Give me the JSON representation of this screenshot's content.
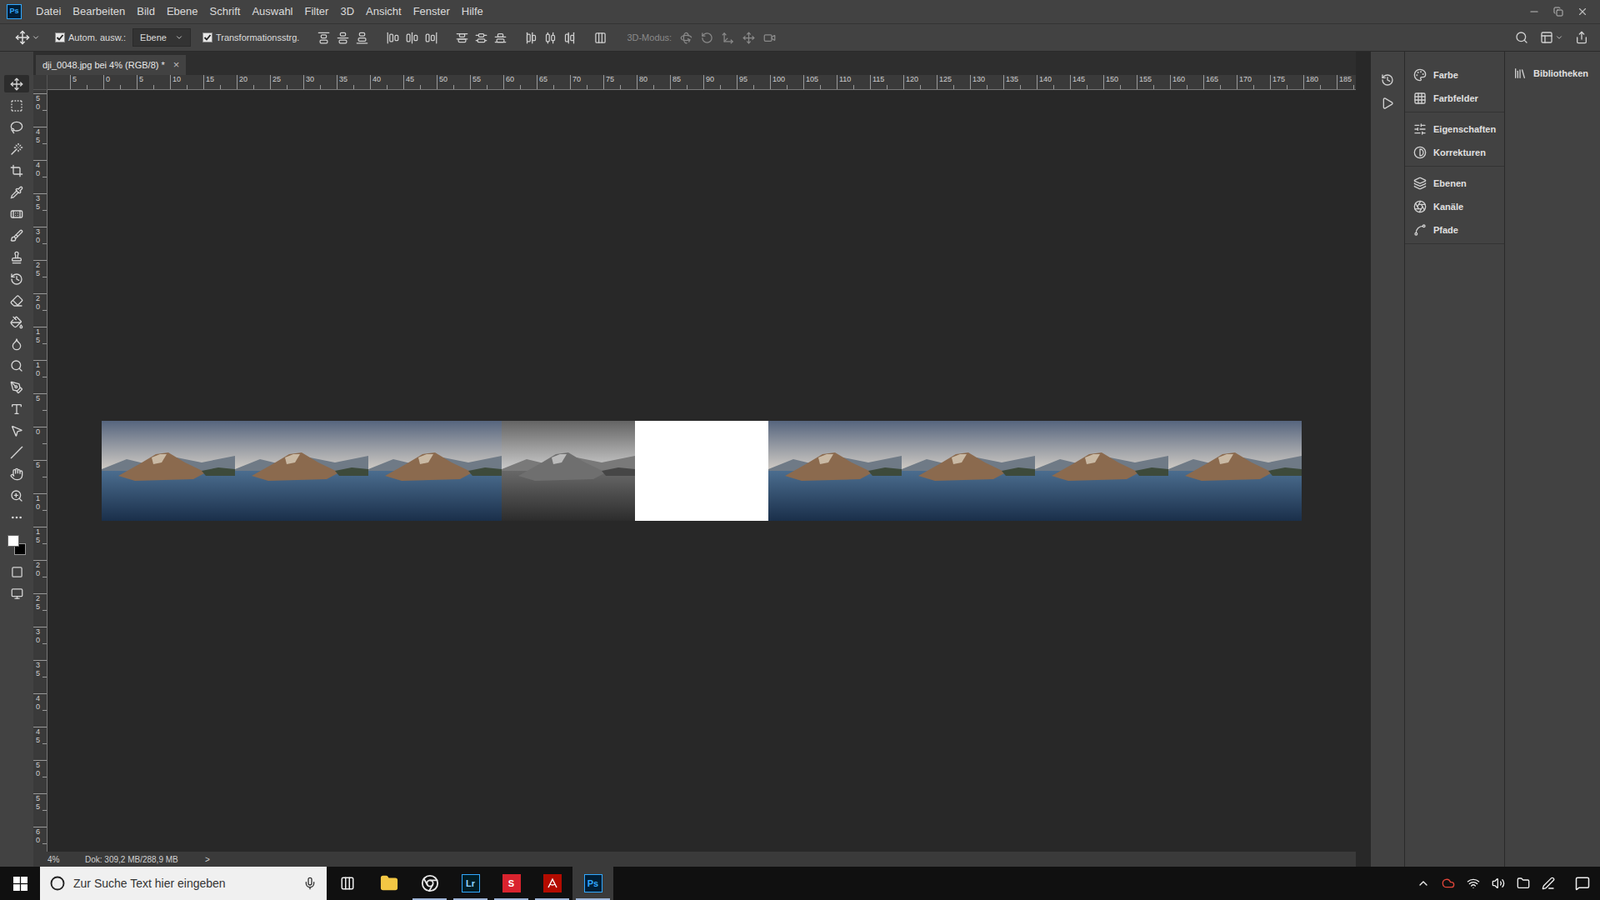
{
  "menu_bar": {
    "app_badge": "Ps",
    "items": [
      "Datei",
      "Bearbeiten",
      "Bild",
      "Ebene",
      "Schrift",
      "Auswahl",
      "Filter",
      "3D",
      "Ansicht",
      "Fenster",
      "Hilfe"
    ]
  },
  "options_bar": {
    "auto_select": {
      "label": "Autom. ausw.:",
      "checked": true
    },
    "auto_select_target": "Ebene",
    "transform_controls": {
      "label": "Transformationsstrg.",
      "checked": true
    },
    "mode_3d": {
      "label": "3D-Modus:",
      "disabled": true
    }
  },
  "document_tab": {
    "title": "dji_0048.jpg bei 4% (RGB/8) *",
    "close": "×",
    "selected": true
  },
  "toolbar": {
    "tools": [
      {
        "kind": "move",
        "selected": true
      },
      {
        "kind": "marquee",
        "selected": false
      },
      {
        "kind": "lasso",
        "selected": false
      },
      {
        "kind": "wand",
        "selected": false
      },
      {
        "kind": "crop",
        "selected": false
      },
      {
        "kind": "eyedropper",
        "selected": false
      },
      {
        "kind": "heal",
        "selected": false
      },
      {
        "kind": "brush",
        "selected": false
      },
      {
        "kind": "stamp",
        "selected": false
      },
      {
        "kind": "history",
        "selected": false
      },
      {
        "kind": "eraser",
        "selected": false
      },
      {
        "kind": "bucket",
        "selected": false
      },
      {
        "kind": "blur",
        "selected": false
      },
      {
        "kind": "dodge",
        "selected": false
      },
      {
        "kind": "pen",
        "selected": false
      },
      {
        "kind": "type",
        "selected": false
      },
      {
        "kind": "select",
        "selected": false
      },
      {
        "kind": "line",
        "selected": false
      },
      {
        "kind": "hand",
        "selected": false
      },
      {
        "kind": "zoom",
        "selected": false
      },
      {
        "kind": "more",
        "selected": false
      }
    ],
    "foreground_color": "#ffffff",
    "background_color": "#000000"
  },
  "ruler": {
    "horizontal": [
      "5",
      "0",
      "5",
      "10",
      "15",
      "20",
      "25",
      "30",
      "35",
      "40",
      "45",
      "50",
      "55",
      "60",
      "65",
      "70",
      "75",
      "80",
      "85",
      "90",
      "95",
      "100",
      "105",
      "110",
      "115",
      "120",
      "125",
      "130",
      "135",
      "140",
      "145",
      "150",
      "155",
      "160",
      "165",
      "170",
      "175",
      "180",
      "185"
    ],
    "vertical": [
      "50",
      "45",
      "40",
      "35",
      "30",
      "25",
      "20",
      "15",
      "10",
      "5",
      "0",
      "5",
      "10",
      "15",
      "20",
      "25",
      "30",
      "35",
      "40",
      "45",
      "50",
      "55",
      "60"
    ]
  },
  "canvas": {
    "tiles": [
      {
        "kind": "photo"
      },
      {
        "kind": "photo"
      },
      {
        "kind": "photo"
      },
      {
        "kind": "photo-gray"
      },
      {
        "kind": "document"
      },
      {
        "kind": "photo"
      },
      {
        "kind": "photo"
      },
      {
        "kind": "photo"
      },
      {
        "kind": "photo"
      }
    ]
  },
  "status_bar": {
    "zoom": "4%",
    "doc_size": "Dok: 309,2 MB/288,9 MB",
    "arrow": ">"
  },
  "panels": {
    "collapsed": [
      {
        "kind": "history"
      },
      {
        "kind": "actions"
      }
    ],
    "groups": [
      [
        {
          "label": "Farbe",
          "kind": "color"
        },
        {
          "label": "Farbfelder",
          "kind": "swatches"
        }
      ],
      [
        {
          "label": "Eigenschaften",
          "kind": "properties"
        },
        {
          "label": "Korrekturen",
          "kind": "adjustments"
        }
      ],
      [
        {
          "label": "Ebenen",
          "kind": "layers"
        },
        {
          "label": "Kanäle",
          "kind": "channels"
        },
        {
          "label": "Pfade",
          "kind": "paths"
        }
      ]
    ],
    "libraries": {
      "label": "Bibliotheken",
      "kind": "libraries"
    }
  },
  "taskbar": {
    "search_placeholder": "Zur Suche Text hier eingeben",
    "apps": [
      {
        "kind": "explorer",
        "badge": "",
        "running": false,
        "selected": false
      },
      {
        "kind": "chrome",
        "badge": "",
        "running": true,
        "selected": false
      },
      {
        "kind": "lightroom",
        "badge": "Lr",
        "running": true,
        "selected": false
      },
      {
        "kind": "s-app",
        "badge": "S",
        "running": true,
        "selected": false
      },
      {
        "kind": "acrobat",
        "badge": "",
        "running": true,
        "selected": false
      },
      {
        "kind": "photoshop",
        "badge": "Ps",
        "running": true,
        "selected": true
      }
    ]
  }
}
